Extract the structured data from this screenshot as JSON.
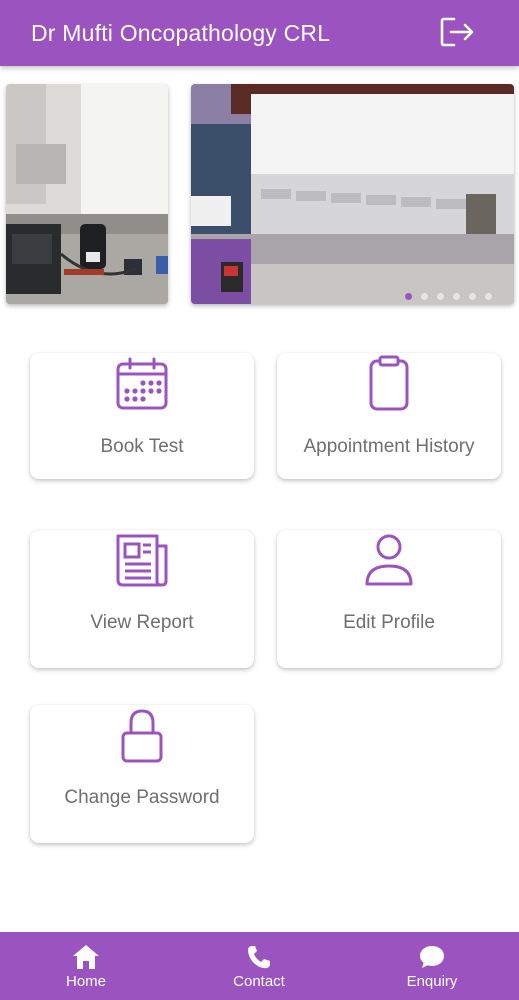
{
  "header": {
    "title": "Dr Mufti Oncopathology CRL",
    "logout_icon": "logout-icon"
  },
  "carousel": {
    "slide_count": 6,
    "active_index": 0
  },
  "menu": {
    "book_test": {
      "label": "Book Test",
      "icon": "calendar-icon"
    },
    "appointment_history": {
      "label": "Appointment History",
      "icon": "clipboard-icon"
    },
    "view_report": {
      "label": "View Report",
      "icon": "newspaper-icon"
    },
    "edit_profile": {
      "label": "Edit Profile",
      "icon": "user-icon"
    },
    "change_password": {
      "label": "Change Password",
      "icon": "lock-icon"
    }
  },
  "bottom_nav": {
    "home": {
      "label": "Home",
      "icon": "home-icon"
    },
    "contact": {
      "label": "Contact",
      "icon": "phone-icon"
    },
    "enquiry": {
      "label": "Enquiry",
      "icon": "chat-icon"
    }
  },
  "colors": {
    "primary": "#9a53bf",
    "label_text": "#6f6f6f",
    "background": "#ffffff"
  }
}
